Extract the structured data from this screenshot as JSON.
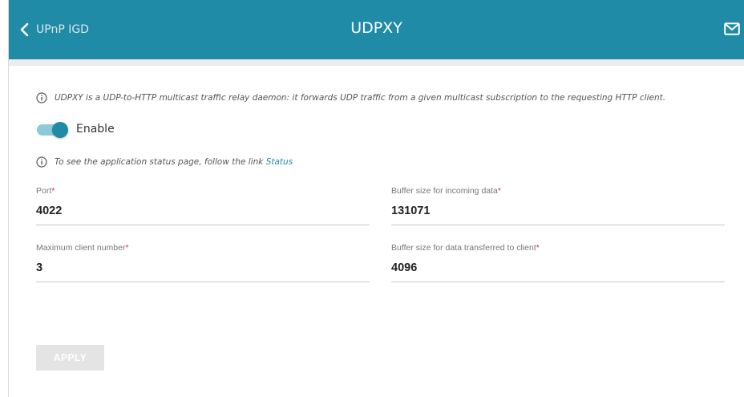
{
  "header": {
    "back_label": "UPnP IGD",
    "title": "UDPXY",
    "accent_color": "#1f8ba6"
  },
  "info": {
    "description": "UDPXY is a UDP-to-HTTP multicast traffic relay daemon: it forwards UDP traffic from a given multicast subscription to the requesting HTTP client.",
    "status_hint": "To see the application status page, follow the link ",
    "status_link": "Status"
  },
  "enable": {
    "label": "Enable",
    "checked": true
  },
  "fields": {
    "port": {
      "label": "Port",
      "required": "*",
      "value": "4022"
    },
    "buffer_in": {
      "label": "Buffer size for incoming data",
      "required": "*",
      "value": "131071"
    },
    "max_clients": {
      "label": "Maximum client number",
      "required": "*",
      "value": "3"
    },
    "buffer_out": {
      "label": "Buffer size for data transferred to client",
      "required": "*",
      "value": "4096"
    }
  },
  "actions": {
    "apply_label": "APPLY"
  },
  "icons": {
    "back": "chevron-left-icon",
    "mail": "mail-icon",
    "info": "info-icon"
  }
}
